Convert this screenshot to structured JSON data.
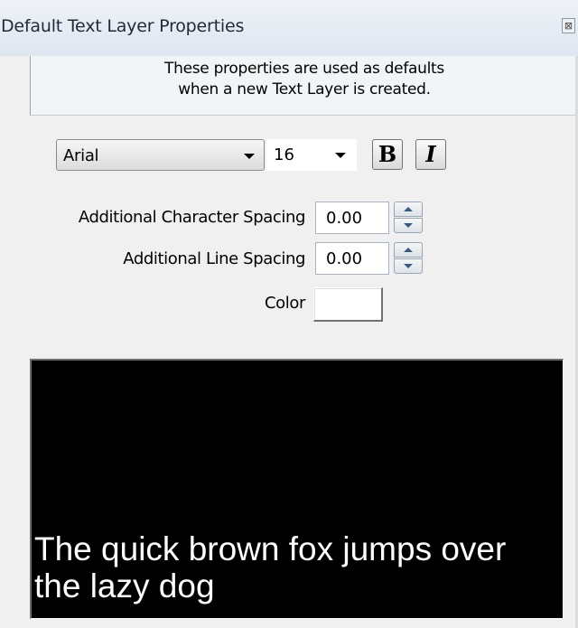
{
  "window": {
    "title": "Default Text Layer Properties",
    "close_glyph": "⊠"
  },
  "info": {
    "line1": "These properties are used as defaults",
    "line2": "when a new Text Layer is created."
  },
  "font": {
    "family": "Arial",
    "size": "16",
    "bold_label": "B",
    "italic_label": "I"
  },
  "spacing": {
    "char_label": "Additional Character Spacing",
    "char_value": "0.00",
    "line_label": "Additional Line Spacing",
    "line_value": "0.00"
  },
  "color": {
    "label": "Color",
    "value": "#ffffff"
  },
  "preview": {
    "text": "The quick brown fox jumps over the lazy dog",
    "background": "#000000",
    "text_color": "#ffffff"
  }
}
